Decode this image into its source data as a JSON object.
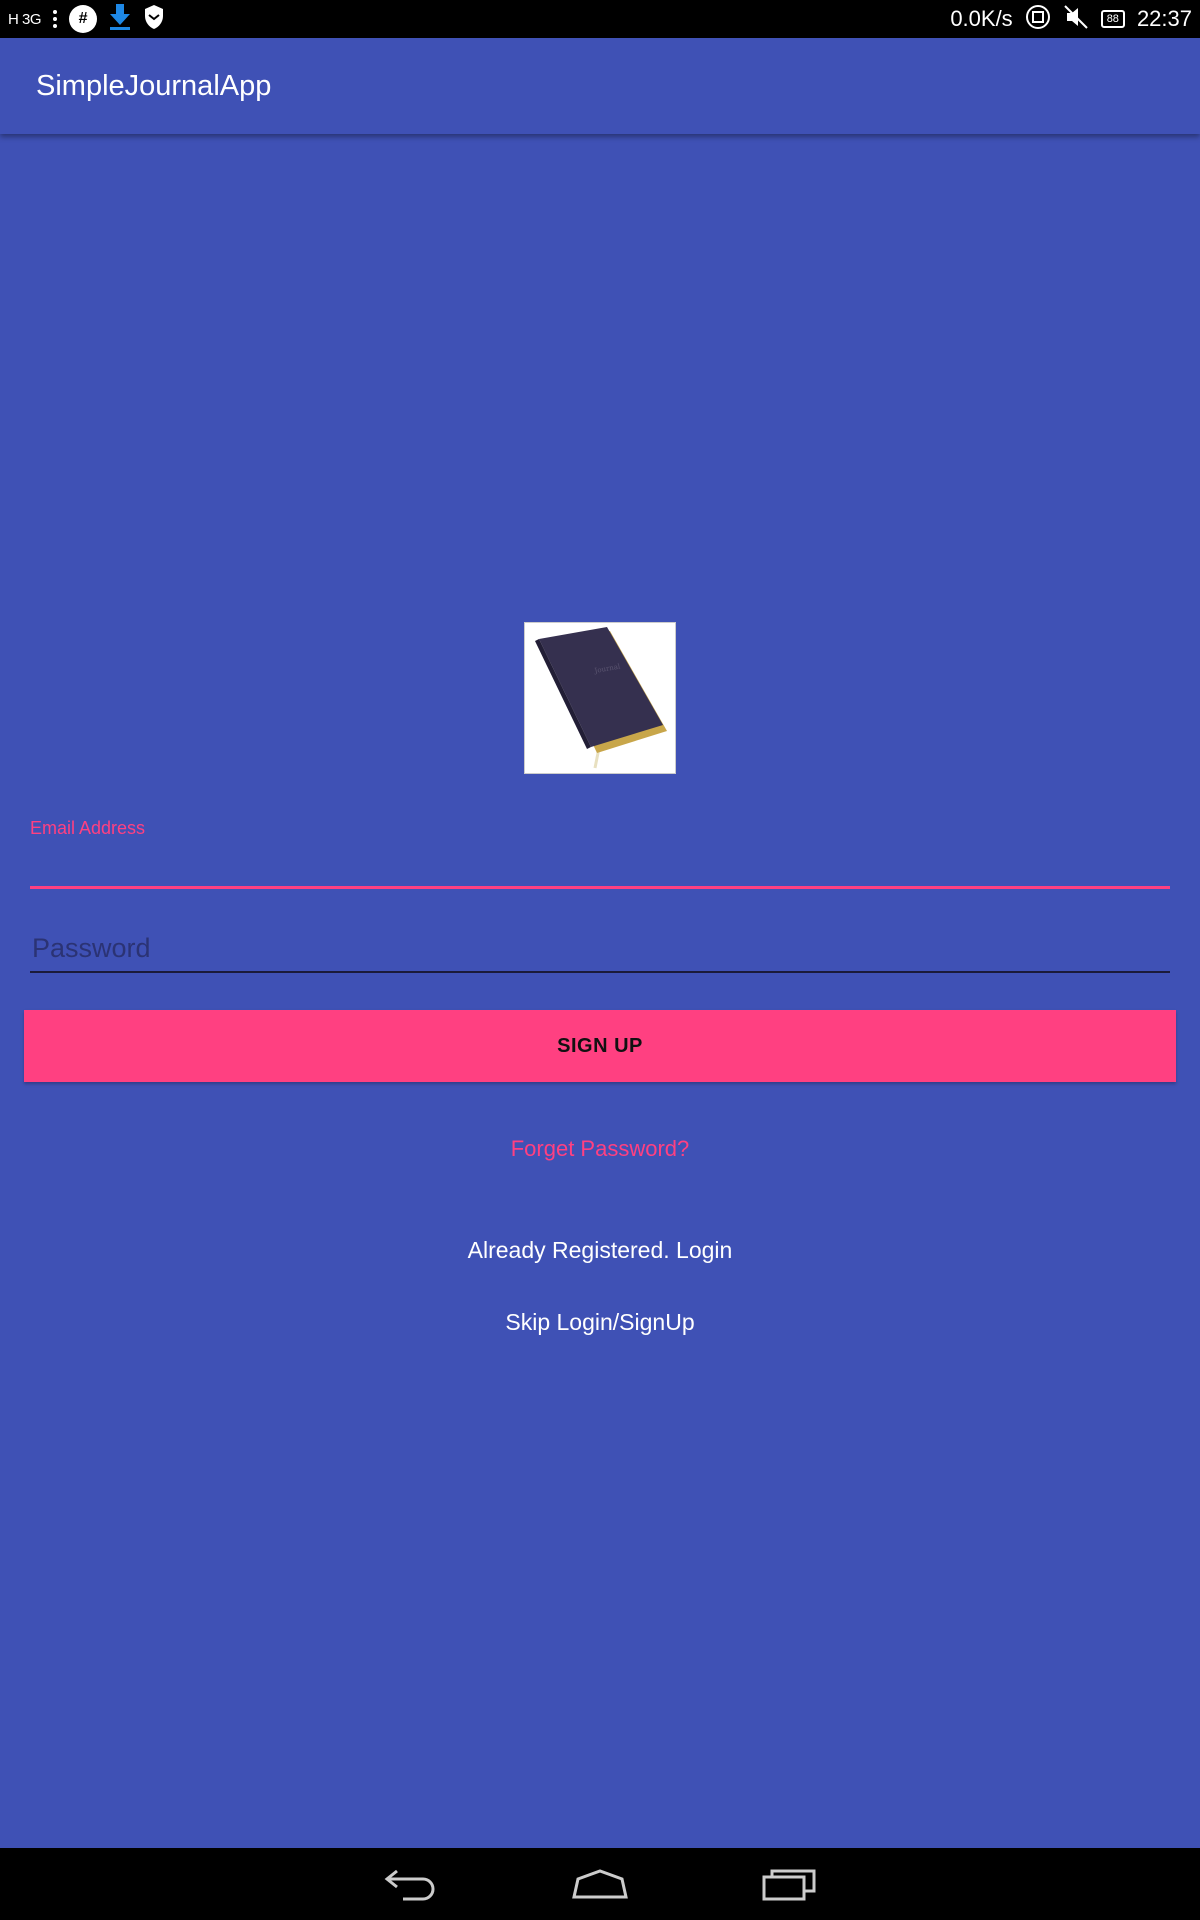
{
  "status_bar": {
    "signal": "H 3G",
    "speed": "0.0K/s",
    "battery": "88",
    "time": "22:37"
  },
  "app_bar": {
    "title": "SimpleJournalApp"
  },
  "form": {
    "email_label": "Email Address",
    "email_value": "",
    "password_placeholder": "Password",
    "password_value": "",
    "signup_label": "SIGN UP",
    "forgot_label": "Forget Password?",
    "login_label": "Already Registered. Login",
    "skip_label": "Skip Login/SignUp"
  },
  "colors": {
    "primary": "#3f51b5",
    "accent": "#ff4081"
  },
  "icons": {
    "logo": "journal-book-icon",
    "nav": [
      "back-icon",
      "home-icon",
      "recents-icon"
    ]
  }
}
